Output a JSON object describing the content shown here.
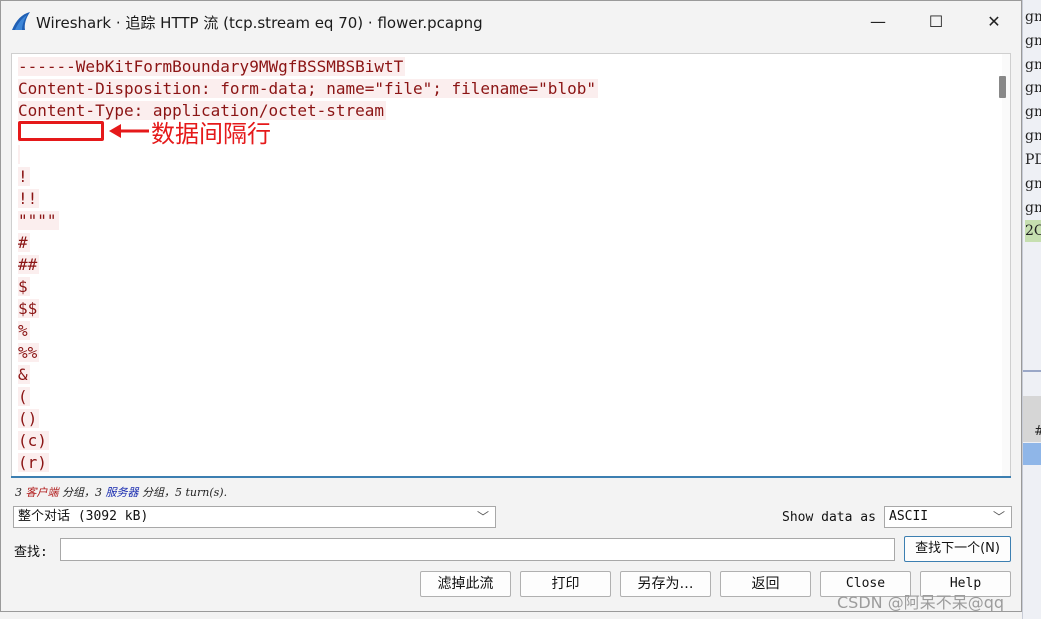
{
  "window": {
    "title": "Wireshark · 追踪 HTTP 流 (tcp.stream eq 70) · flower.pcapng",
    "minimize": "—",
    "maximize": "☐",
    "close": "✕"
  },
  "content": {
    "lines": [
      "------WebKitFormBoundary9MWgfBSSMBSBiwtT",
      "Content-Disposition: form-data; name=\"file\"; filename=\"blob\"",
      "Content-Type: application/octet-stream",
      "",
      "",
      "!",
      "!!",
      "\"\"\"\"",
      "#",
      "##",
      "$",
      "$$",
      "%",
      "%%",
      "&",
      "(",
      "()",
      "(c)",
      "(r)"
    ]
  },
  "annotation": {
    "text": "数据间隔行",
    "color": "#e5191a"
  },
  "status": {
    "p1": "3 ",
    "client": "客户端",
    "p2": " 分组，3 ",
    "server": "服务器",
    "p3": " 分组，5 turn(s)."
  },
  "controls": {
    "conversation_select": "整个对话 (3092 kB)",
    "show_data_label": "Show data as",
    "show_data_value": "ASCII",
    "find_label": "查找:",
    "find_value": "",
    "find_next_button": "查找下一个(N)"
  },
  "buttons": {
    "filter_out": "滤掉此流",
    "print": "打印",
    "save_as": "另存为…",
    "back": "返回",
    "close": "Close",
    "help": "Help"
  },
  "background_window": {
    "rows": [
      "gm",
      "gm",
      "gm",
      "gm",
      "gm",
      "gm",
      "PD",
      "gm",
      "gm",
      "2C"
    ],
    "hash": "#"
  },
  "watermark": "CSDN @阿呆不呆@qq"
}
